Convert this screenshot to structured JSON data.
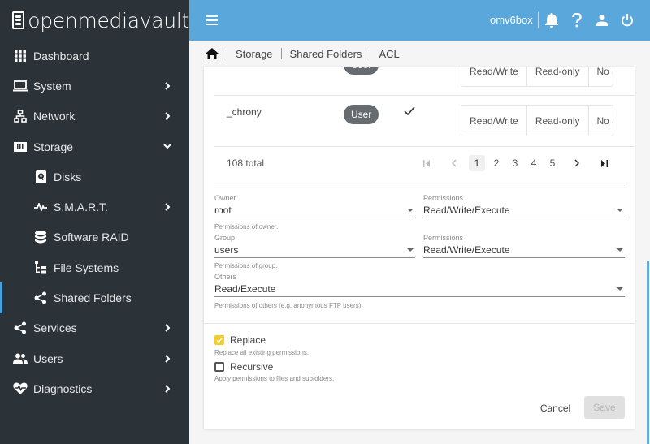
{
  "app": {
    "logo_text": "openmediavault",
    "hostname": "omv6box"
  },
  "colors": {
    "sidebar_bg": "#2b3238",
    "topbar_bg": "#5aa7dc",
    "accent": "#4ca0d8",
    "checkbox_checked": "#f4ce2e"
  },
  "sidebar": {
    "items": [
      {
        "label": "Dashboard",
        "icon": "grid-icon",
        "chevron": false
      },
      {
        "label": "System",
        "icon": "laptop-icon",
        "chevron": "right"
      },
      {
        "label": "Network",
        "icon": "network-icon",
        "chevron": "right"
      },
      {
        "label": "Storage",
        "icon": "storage-icon",
        "chevron": "down"
      },
      {
        "label": "Disks",
        "icon": "disk-icon",
        "sub": true
      },
      {
        "label": "S.M.A.R.T.",
        "icon": "pulse-icon",
        "sub": true,
        "chevron": "right"
      },
      {
        "label": "Software RAID",
        "icon": "database-icon",
        "sub": true
      },
      {
        "label": "File Systems",
        "icon": "file-tree-icon",
        "sub": true
      },
      {
        "label": "Shared Folders",
        "icon": "share-icon",
        "sub": true,
        "active": true
      },
      {
        "label": "Services",
        "icon": "share-icon",
        "chevron": "right"
      },
      {
        "label": "Users",
        "icon": "users-icon",
        "chevron": "right"
      },
      {
        "label": "Diagnostics",
        "icon": "heart-pulse-icon",
        "chevron": "right"
      }
    ]
  },
  "breadcrumb": {
    "items": [
      "Storage",
      "Shared Folders",
      "ACL"
    ]
  },
  "table": {
    "rows": [
      {
        "name": "",
        "type": "User",
        "perm_options": [
          "Read/Write",
          "Read-only",
          "No ac"
        ]
      },
      {
        "name": "_chrony",
        "type": "User",
        "checked": true,
        "perm_options": [
          "Read/Write",
          "Read-only",
          "No ac"
        ]
      }
    ],
    "total_label": "108 total",
    "pages": [
      "1",
      "2",
      "3",
      "4",
      "5"
    ],
    "current_page": "1"
  },
  "form": {
    "owner": {
      "label": "Owner",
      "value": "root",
      "hint": "Permissions of owner."
    },
    "owner_perm": {
      "label": "Permissions",
      "value": "Read/Write/Execute"
    },
    "group": {
      "label": "Group",
      "value": "users",
      "hint": "Permissions of group."
    },
    "group_perm": {
      "label": "Permissions",
      "value": "Read/Write/Execute"
    },
    "others": {
      "label": "Others",
      "value": "Read/Execute",
      "hint": "Permissions of others (e.g. anonymous FTP users)."
    },
    "replace": {
      "label": "Replace",
      "checked": true,
      "hint": "Replace all existing permissions."
    },
    "recursive": {
      "label": "Recursive",
      "checked": false,
      "hint": "Apply permissions to files and subfolders."
    },
    "cancel_label": "Cancel",
    "save_label": "Save"
  }
}
